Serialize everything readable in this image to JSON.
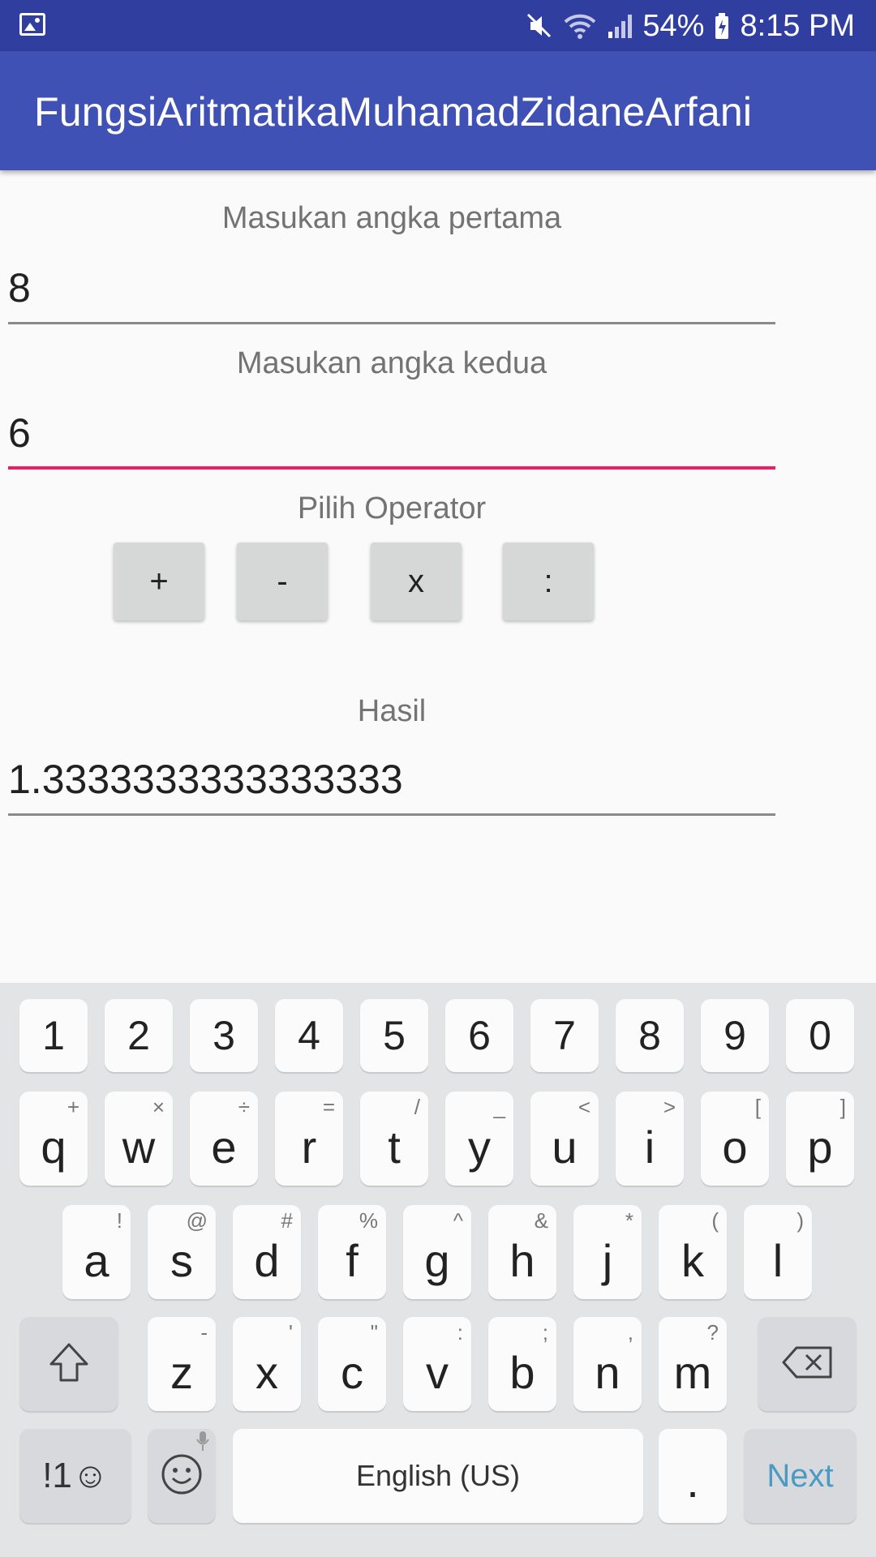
{
  "status_bar": {
    "battery": "54%",
    "time": "8:15 PM",
    "icons": [
      "gallery-icon",
      "mute-icon",
      "wifi-icon",
      "signal-icon",
      "battery-icon"
    ]
  },
  "app_bar": {
    "title": "FungsiAritmatikaMuhamadZidaneArfani"
  },
  "form": {
    "first_label": "Masukan angka pertama",
    "first_value": "8",
    "second_label": "Masukan angka kedua",
    "second_value": "6",
    "operator_label": "Pilih Operator",
    "operators": [
      "+",
      "-",
      "x",
      ":"
    ],
    "result_label": "Hasil",
    "result_value": "1.3333333333333333"
  },
  "keyboard": {
    "numbers": [
      "1",
      "2",
      "3",
      "4",
      "5",
      "6",
      "7",
      "8",
      "9",
      "0"
    ],
    "row1": [
      {
        "main": "q",
        "sub": "+"
      },
      {
        "main": "w",
        "sub": "×"
      },
      {
        "main": "e",
        "sub": "÷"
      },
      {
        "main": "r",
        "sub": "="
      },
      {
        "main": "t",
        "sub": "/"
      },
      {
        "main": "y",
        "sub": "_"
      },
      {
        "main": "u",
        "sub": "<"
      },
      {
        "main": "i",
        "sub": ">"
      },
      {
        "main": "o",
        "sub": "["
      },
      {
        "main": "p",
        "sub": "]"
      }
    ],
    "row2": [
      {
        "main": "a",
        "sub": "!"
      },
      {
        "main": "s",
        "sub": "@"
      },
      {
        "main": "d",
        "sub": "#"
      },
      {
        "main": "f",
        "sub": "%"
      },
      {
        "main": "g",
        "sub": "^"
      },
      {
        "main": "h",
        "sub": "&"
      },
      {
        "main": "j",
        "sub": "*"
      },
      {
        "main": "k",
        "sub": "("
      },
      {
        "main": "l",
        "sub": ")"
      }
    ],
    "row3": [
      {
        "main": "z",
        "sub": "-"
      },
      {
        "main": "x",
        "sub": "'"
      },
      {
        "main": "c",
        "sub": "\""
      },
      {
        "main": "v",
        "sub": ":"
      },
      {
        "main": "b",
        "sub": ";"
      },
      {
        "main": "n",
        "sub": ","
      },
      {
        "main": "m",
        "sub": "?"
      }
    ],
    "symbols_label": "!1☺",
    "space_label": "English (US)",
    "period_label": ".",
    "next_label": "Next",
    "colors": {
      "background": "#e3e4e6",
      "key": "#fbfbfb",
      "next_text": "#4a9ac3"
    }
  },
  "colors": {
    "status_bar": "#303f9f",
    "app_bar": "#3f51b5",
    "focus_underline": "#e91e63"
  }
}
